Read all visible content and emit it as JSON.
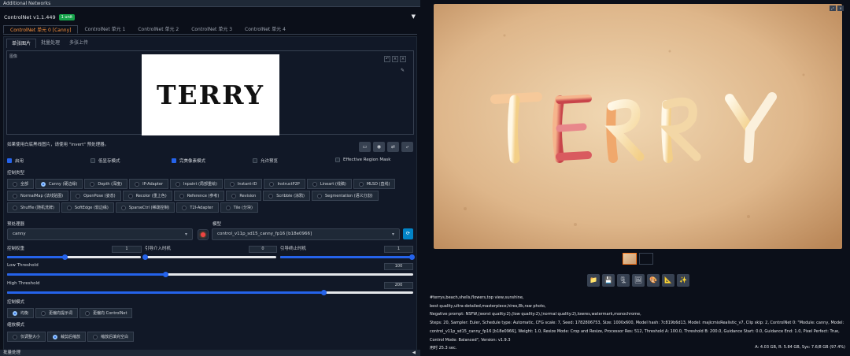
{
  "top_bar": {
    "label": "Additional Networks"
  },
  "controlnet": {
    "title": "ControlNet v1.1.449",
    "badge": "1 unit",
    "unit_tabs": [
      "ControlNet 单元 0 [Canny]",
      "ControlNet 单元 1",
      "ControlNet 单元 2",
      "ControlNet 单元 3",
      "ControlNet 单元 4"
    ],
    "sub_tabs": [
      "单张图片",
      "批量处理",
      "多张上传"
    ],
    "image_label": "图像",
    "canvas_text": "TERRY",
    "hint": "如果使用白底黑线图片，请使用 \"invert\" 预处理器。",
    "checkboxes": [
      {
        "label": "启用",
        "checked": true
      },
      {
        "label": "低显存模式",
        "checked": false
      },
      {
        "label": "完美像素模式",
        "checked": true
      },
      {
        "label": "允许预览",
        "checked": false
      },
      {
        "label": "Effective Region Mask",
        "checked": false
      }
    ],
    "control_type_label": "控制类型",
    "control_types_rows": [
      [
        "全部",
        "Canny (硬边缘)",
        "Depth (深度)",
        "IP-Adapter",
        "Inpaint (局部重绘)",
        "Instant-ID",
        "InstructP2P",
        "Lineart (线稿)",
        "MLSD (直线)"
      ],
      [
        "NormalMap (法线贴图)",
        "OpenPose (姿态)",
        "Recolor (重上色)",
        "Reference (参考)",
        "Revision",
        "Scribble (涂鸦)",
        "Segmentation (语义分割)"
      ],
      [
        "Shuffle (随机洗牌)",
        "SoftEdge (软边缘)",
        "SparseCtrl (稀疏控制)",
        "T2I-Adapter",
        "Tile (分块)"
      ]
    ],
    "selected_type": "Canny (硬边缘)",
    "preprocessor_label": "预处理器",
    "preprocessor_value": "canny",
    "model_label": "模型",
    "model_value": "control_v11p_sd15_canny_fp16 [b18e0966]",
    "weight_label": "控制权重",
    "weight_value": "1",
    "start_label": "引导介入时机",
    "start_value": "0",
    "end_label": "引导终止时机",
    "end_value": "1",
    "low_threshold_label": "Low Threshold",
    "low_threshold_value": "100",
    "high_threshold_label": "High Threshold",
    "high_threshold_value": "200",
    "control_mode_label": "控制模式",
    "control_modes": [
      "均衡",
      "更偏向提示词",
      "更偏向 ControlNet"
    ],
    "resize_mode_label": "缩放模式",
    "resize_modes": [
      "仅调整大小",
      "裁剪后缩放",
      "缩放后填充空白"
    ],
    "bottom_label": "批量处理"
  },
  "sliders": {
    "weight": 0.43,
    "start": 0.0,
    "end": 1.0,
    "low_threshold": 0.39,
    "high_threshold": 0.78
  },
  "output": {
    "image_text": "TERRY",
    "info_lines": [
      "#terrys,beach,shells,flowers,top view,sunshine,",
      "best quality,ultra-detailed,masterpiece,hires,8k,raw photo,",
      "Negative prompt: NSFW,(worst quality:2),(low quality:2),(normal quality:2),lowres,watermark,monochrome,",
      "Steps: 20, Sampler: Euler, Schedule type: Automatic, CFG scale: 7, Seed: 1782806753, Size: 1000x600, Model hash: 7c819b6d13, Model: majicmixRealistic_v7, Clip skip: 2, ControlNet 0: \"Module: canny, Model:",
      "control_v11p_sd15_canny_fp16 [b18e0966], Weight: 1.0, Resize Mode: Crop and Resize, Processor Res: 512, Threshold A: 100.0, Threshold B: 200.0, Guidance Start: 0.0, Guidance End: 1.0, Pixel Perfect: True,",
      "Control Mode: Balanced\", Version: v1.9.3"
    ],
    "time": "用时 25.3 sec.",
    "vram": "A: 4.03 GB, R: 5.84 GB, Sys: 7.6/8 GB (97.4%)"
  }
}
